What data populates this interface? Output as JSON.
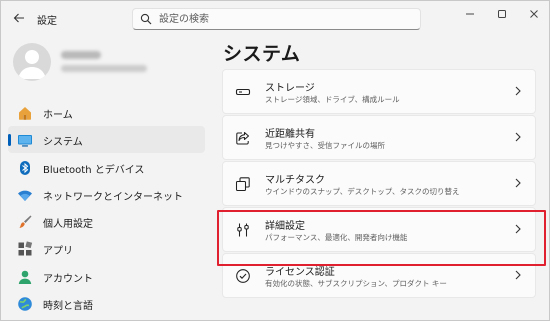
{
  "window": {
    "title": "設定",
    "controls": [
      "minimize",
      "maximize",
      "close"
    ]
  },
  "search": {
    "placeholder": "設定の検索"
  },
  "profile": {
    "avatar_icon": "person-icon"
  },
  "sidebar": {
    "items": [
      {
        "label": "ホーム",
        "icon": "home-icon",
        "active": false
      },
      {
        "label": "システム",
        "icon": "system-icon",
        "active": true
      },
      {
        "label": "Bluetooth とデバイス",
        "icon": "bluetooth-icon",
        "active": false
      },
      {
        "label": "ネットワークとインターネット",
        "icon": "wifi-icon",
        "active": false
      },
      {
        "label": "個人用設定",
        "icon": "brush-icon",
        "active": false
      },
      {
        "label": "アプリ",
        "icon": "apps-icon",
        "active": false
      },
      {
        "label": "アカウント",
        "icon": "account-icon",
        "active": false
      },
      {
        "label": "時刻と言語",
        "icon": "globe-icon",
        "active": false
      }
    ]
  },
  "main": {
    "title": "システム",
    "items": [
      {
        "title": "ストレージ",
        "subtitle": "ストレージ領域、ドライブ、構成ルール",
        "icon": "storage-icon"
      },
      {
        "title": "近距離共有",
        "subtitle": "見つけやすさ、受信ファイルの場所",
        "icon": "share-icon"
      },
      {
        "title": "マルチタスク",
        "subtitle": "ウインドウのスナップ、デスクトップ、タスクの切り替え",
        "icon": "multitask-icon"
      },
      {
        "title": "詳細設定",
        "subtitle": "パフォーマンス、最適化、開発者向け機能",
        "icon": "advanced-settings-icon",
        "highlighted": true
      },
      {
        "title": "ライセンス認証",
        "subtitle": "有効化の状態、サブスクリプション、プロダクト キー",
        "icon": "activation-icon"
      }
    ]
  },
  "colors": {
    "accent": "#005fb8",
    "highlight_border": "#e0202e",
    "window_bg": "#f3f3f3",
    "card_bg": "#fbfbfb"
  }
}
